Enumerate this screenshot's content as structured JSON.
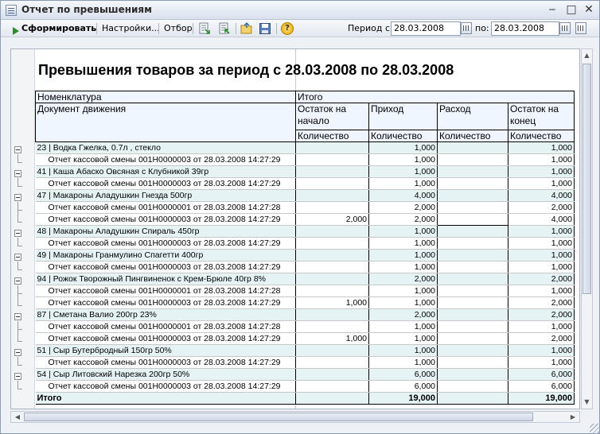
{
  "window": {
    "title": "Отчет по превышениям",
    "minimize_glyph": "‒",
    "maximize_glyph": "□",
    "close_glyph": "✕"
  },
  "toolbar": {
    "generate_label": "Сформировать",
    "settings_label": "Настройки...",
    "filter_label": "Отбор",
    "period_from_label": "Период с:",
    "period_from_value": "28.03.2008",
    "period_to_label": "по:",
    "period_to_value": "28.03.2008",
    "help_glyph": "?",
    "icons": [
      "play-icon",
      "expand-icon",
      "collapse-icon",
      "open-folder-icon",
      "save-icon",
      "help-icon"
    ]
  },
  "report": {
    "title": "Превышения товаров за период с 28.03.2008 по 28.03.2008",
    "header": {
      "nomenclature": "Номенклатура",
      "total": "Итого",
      "document": "Документ движения",
      "col_opening": "Остаток на начало",
      "col_income": "Приход",
      "col_expense": "Расход",
      "col_closing": "Остаток на конец",
      "qty": "Количество"
    },
    "rows": [
      {
        "type": "grp",
        "name": "23 | Водка  Гжелка,  0.7л , стекло",
        "open": "",
        "in": "1,000",
        "out": "",
        "close": "1,000"
      },
      {
        "type": "doc",
        "name": "Отчет кассовой смены 001Н0000003 от 28.03.2008 14:27:29",
        "open": "",
        "in": "1,000",
        "out": "",
        "close": "1,000"
      },
      {
        "type": "grp",
        "name": "41 | Каша Абаско Овсяная с Клубникой 39гр",
        "open": "",
        "in": "1,000",
        "out": "",
        "close": "1,000"
      },
      {
        "type": "doc",
        "name": "Отчет кассовой смены 001Н0000003 от 28.03.2008 14:27:29",
        "open": "",
        "in": "1,000",
        "out": "",
        "close": "1,000"
      },
      {
        "type": "grp",
        "name": "47 | Макароны Аладушкин Гнезда 500гр",
        "open": "",
        "in": "4,000",
        "out": "",
        "close": "4,000"
      },
      {
        "type": "doc",
        "name": "Отчет кассовой смены 001Н0000001 от 28.03.2008 14:27:28",
        "open": "",
        "in": "2,000",
        "out": "",
        "close": "2,000"
      },
      {
        "type": "doc",
        "name": "Отчет кассовой смены 001Н0000003 от 28.03.2008 14:27:29",
        "open": "2,000",
        "in": "2,000",
        "out": "",
        "close": "4,000",
        "hilite": true
      },
      {
        "type": "grp",
        "name": "48 | Макароны Аладушкин Спираль 450гр",
        "open": "",
        "in": "1,000",
        "out": "",
        "close": "1,000"
      },
      {
        "type": "doc",
        "name": "Отчет кассовой смены 001Н0000003 от 28.03.2008 14:27:29",
        "open": "",
        "in": "1,000",
        "out": "",
        "close": "1,000"
      },
      {
        "type": "grp",
        "name": "49 | Макароны Гранмулино Спагетти 400гр",
        "open": "",
        "in": "1,000",
        "out": "",
        "close": "1,000"
      },
      {
        "type": "doc",
        "name": "Отчет кассовой смены 001Н0000003 от 28.03.2008 14:27:29",
        "open": "",
        "in": "1,000",
        "out": "",
        "close": "1,000"
      },
      {
        "type": "grp",
        "name": "94 | Рожок Творожный Пингвиненок с Крем-Брюле 40гр 8%",
        "open": "",
        "in": "2,000",
        "out": "",
        "close": "2,000"
      },
      {
        "type": "doc",
        "name": "Отчет кассовой смены 001Н0000001 от 28.03.2008 14:27:28",
        "open": "",
        "in": "1,000",
        "out": "",
        "close": "1,000"
      },
      {
        "type": "doc",
        "name": "Отчет кассовой смены 001Н0000003 от 28.03.2008 14:27:29",
        "open": "1,000",
        "in": "1,000",
        "out": "",
        "close": "2,000"
      },
      {
        "type": "grp",
        "name": "87 | Сметана Валио 200гр 23%",
        "open": "",
        "in": "2,000",
        "out": "",
        "close": "2,000"
      },
      {
        "type": "doc",
        "name": "Отчет кассовой смены 001Н0000001 от 28.03.2008 14:27:28",
        "open": "",
        "in": "1,000",
        "out": "",
        "close": "1,000"
      },
      {
        "type": "doc",
        "name": "Отчет кассовой смены 001Н0000003 от 28.03.2008 14:27:29",
        "open": "1,000",
        "in": "1,000",
        "out": "",
        "close": "2,000"
      },
      {
        "type": "grp",
        "name": "51 | Сыр Бутербродный 150гр 50%",
        "open": "",
        "in": "1,000",
        "out": "",
        "close": "1,000"
      },
      {
        "type": "doc",
        "name": "Отчет кассовой смены 001Н0000003 от 28.03.2008 14:27:29",
        "open": "",
        "in": "1,000",
        "out": "",
        "close": "1,000"
      },
      {
        "type": "grp",
        "name": "54 | Сыр Литовский Нарезка 200гр 50%",
        "open": "",
        "in": "6,000",
        "out": "",
        "close": "6,000"
      },
      {
        "type": "doc",
        "name": "Отчет кассовой смены 001Н0000003 от 28.03.2008 14:27:29",
        "open": "",
        "in": "6,000",
        "out": "",
        "close": "6,000"
      }
    ],
    "total_row": {
      "name": "Итого",
      "open": "",
      "in": "19,000",
      "out": "",
      "close": "19,000"
    }
  }
}
